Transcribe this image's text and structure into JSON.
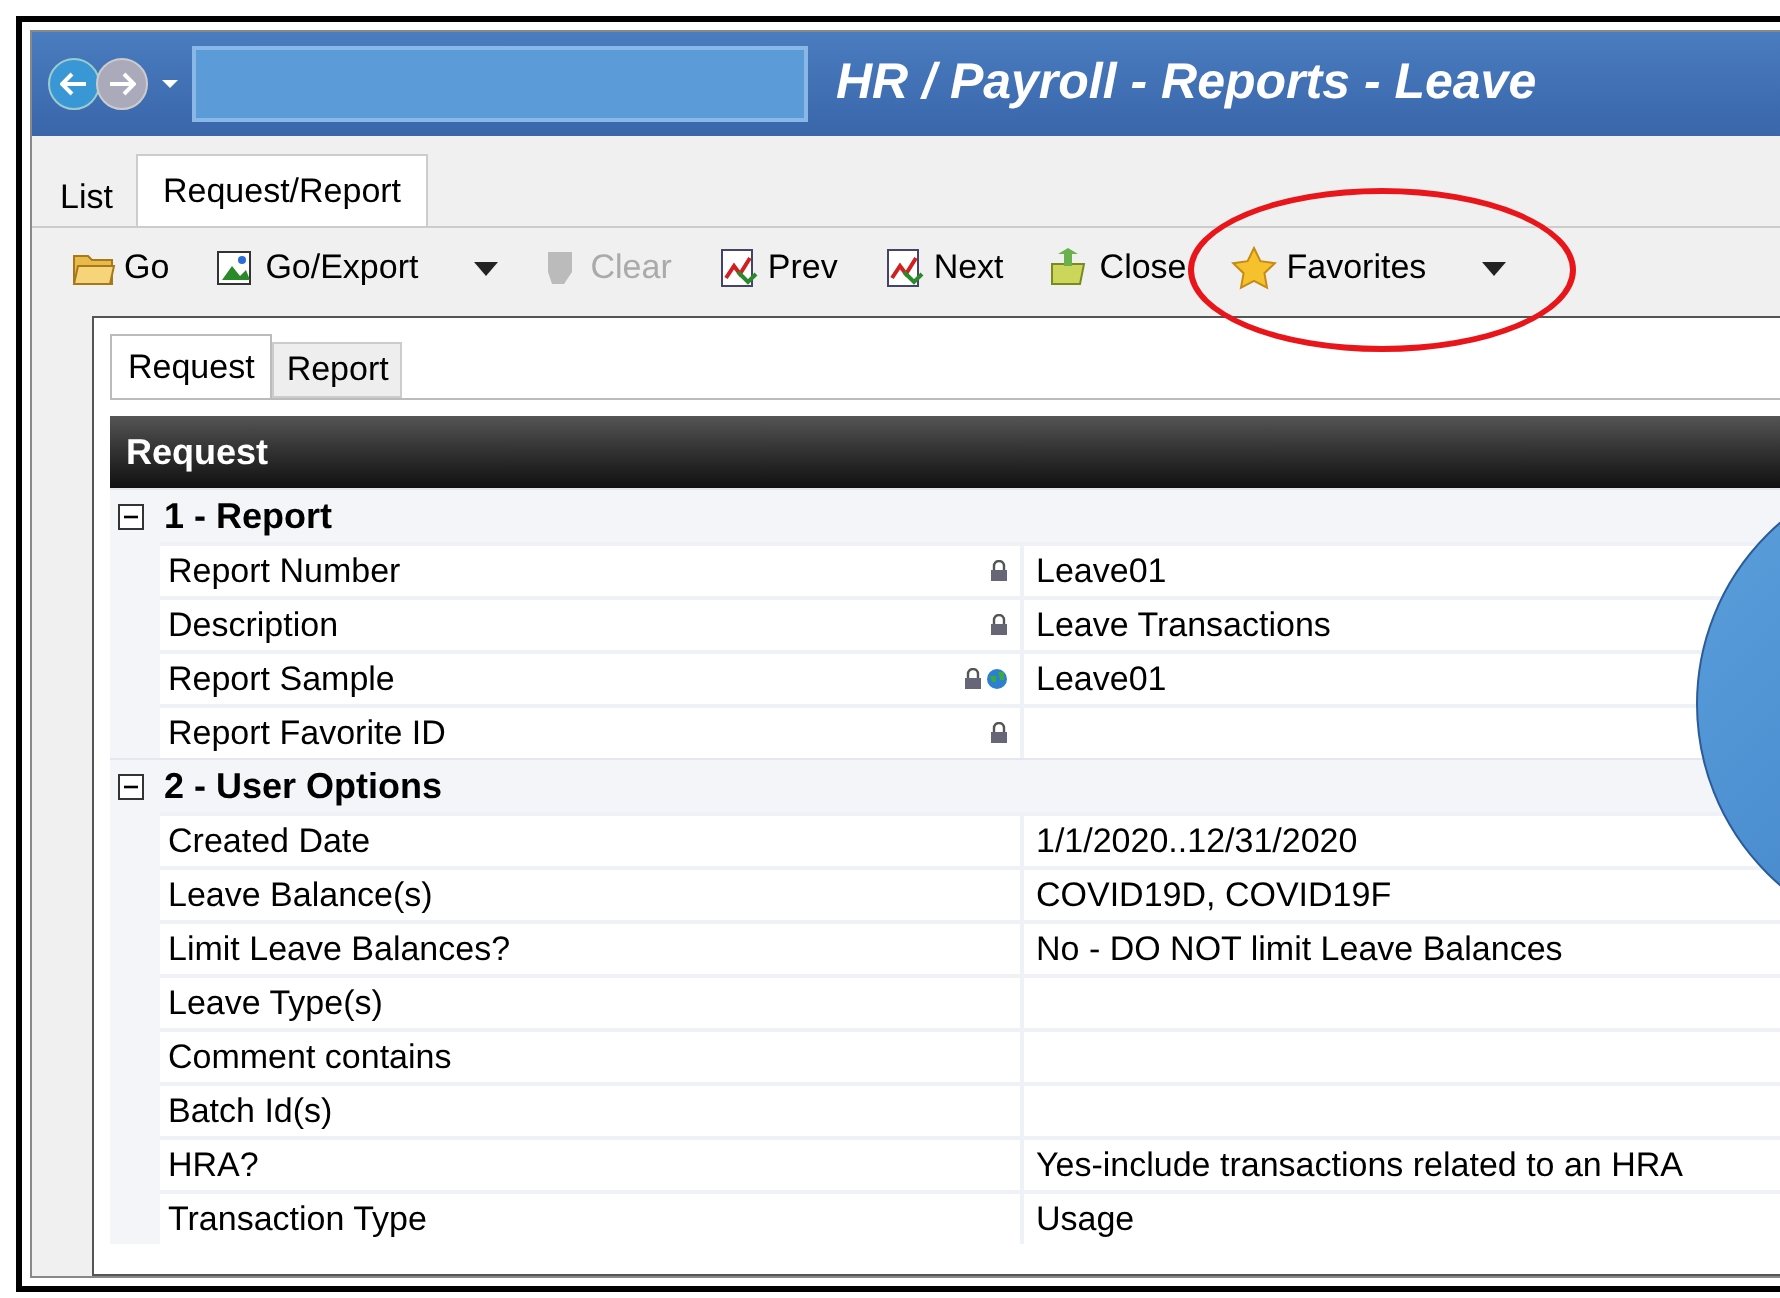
{
  "window": {
    "title": "HR / Payroll - Reports - Leave"
  },
  "tabs": [
    {
      "label": "List",
      "selected": false
    },
    {
      "label": "Request/Report",
      "selected": true
    }
  ],
  "toolbar": [
    {
      "label": "Go",
      "kind": "folder",
      "disabled": false,
      "dropdown": false
    },
    {
      "label": "Go/Export",
      "kind": "export",
      "disabled": false,
      "dropdown": true
    },
    {
      "label": "Clear",
      "kind": "eraser",
      "disabled": true,
      "dropdown": false
    },
    {
      "label": "Prev",
      "kind": "chart",
      "disabled": false,
      "dropdown": false
    },
    {
      "label": "Next",
      "kind": "chart",
      "disabled": false,
      "dropdown": false
    },
    {
      "label": "Close",
      "kind": "close",
      "disabled": false,
      "dropdown": false
    },
    {
      "label": "Favorites",
      "kind": "star",
      "disabled": false,
      "dropdown": true
    }
  ],
  "inner_tabs": [
    {
      "label": "Request",
      "selected": true
    },
    {
      "label": "Report",
      "selected": false
    }
  ],
  "panel": {
    "title": "Request",
    "rows": [
      {
        "kind": "group",
        "label": "1 - Report",
        "expanded": true
      },
      {
        "kind": "field",
        "label": "Report Number",
        "value": "Leave01",
        "locked": true,
        "linked": false
      },
      {
        "kind": "field",
        "label": "Description",
        "value": "Leave Transactions",
        "locked": true,
        "linked": false
      },
      {
        "kind": "field",
        "label": "Report Sample",
        "value": "Leave01",
        "locked": true,
        "linked": true
      },
      {
        "kind": "field",
        "label": "Report Favorite ID",
        "value": "",
        "locked": true,
        "linked": false
      },
      {
        "kind": "group",
        "label": "2 - User Options",
        "expanded": true
      },
      {
        "kind": "field",
        "label": "Created Date",
        "value": "1/1/2020..12/31/2020",
        "locked": false,
        "linked": false
      },
      {
        "kind": "field",
        "label": "Leave Balance(s)",
        "value": "COVID19D, COVID19F",
        "locked": false,
        "linked": false
      },
      {
        "kind": "field",
        "label": "Limit Leave Balances?",
        "value": "No - DO NOT limit Leave Balances",
        "locked": false,
        "linked": false
      },
      {
        "kind": "field",
        "label": "Leave Type(s)",
        "value": "",
        "locked": false,
        "linked": false
      },
      {
        "kind": "field",
        "label": "Comment contains",
        "value": "",
        "locked": false,
        "linked": false
      },
      {
        "kind": "field",
        "label": "Batch Id(s)",
        "value": "",
        "locked": false,
        "linked": false
      },
      {
        "kind": "field",
        "label": "HRA?",
        "value": "Yes-include transactions related to an HRA",
        "locked": false,
        "linked": false
      },
      {
        "kind": "field",
        "label": "Transaction Type",
        "value": "Usage",
        "locked": false,
        "linked": false
      }
    ]
  }
}
